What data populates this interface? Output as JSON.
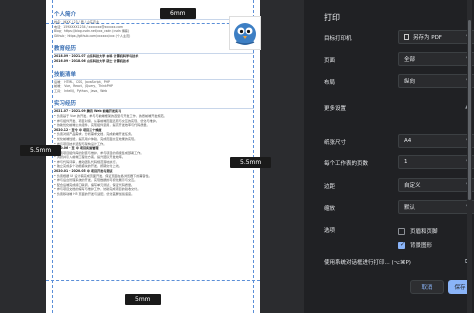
{
  "margins": {
    "top": "6mm",
    "bottom": "5mm",
    "left": "5.5mm",
    "right": "5.5mm"
  },
  "resume": {
    "sections": [
      {
        "title": "个人简介",
        "lines": [
          "姓名：徐XX  |  23 / 男 / 山东农业",
          "电话：159XXXX1234 / xxxxxxx@xxxxxx.com",
          "Blog：https://blog.csdn.net/xxx_csdn  (csdn 博客)",
          "Github：https://github.com/xxxxxx/xxx  (个人主页)"
        ]
      },
      {
        "title": "教育经历",
        "lines": [
          "2018.09 - 2021.07  山东科技大学  本科  计算机科学与技术",
          "2016.09 - 2018.06  山东科技大学  硕士  计算机技术"
        ]
      },
      {
        "title": "技能清单",
        "lines": [
          "后端：  HTML、CSS、JavaScript、PHP",
          "前端：  Vue、React、jQuery、ThinkPHP",
          "工具：  IntelliJ、Python、Java、Web"
        ]
      },
      {
        "title": "实习经历",
        "lines": [
          "2021.07 - 2021.09  腾讯  Web 前端开发实习",
          "负责基于 Vue 的开发，参与与前端框架的选型与开发工作，熟悉前端开发规范。",
          "参与组件开发、项目对接，从事前端页面还原与交互的实现、优化与维护。",
          "协助优化前端公共组件，实现组件复用，提高开发效率与代码质量。",
          "2020.12 - 至今     中    项目三个维度",
          "负责对接产品需求，分析需求文档，完成前端开发任务。",
          "优化前端性能，提高用户体验，完成页面交互效果的实现。",
          "参与项目技术选型与架构设计工作。",
          "2020.06 - 至    中    项目实施管理",
          "负责项目组件库的封装与维护，参与项目的持续集成部署工作。",
          "调研并引入前端工程化方案，提升团队开发效率。",
          "参与代码评审，推动团队代码规范落地执行。",
          "独立完成多个功能模块的开发，按期交付上线。",
          "2020.01 - 2020.05    中    项目开发与测试",
          "负责根据 UI 设计稿完成页面开发，保证页面在各浏览器下的兼容性。",
          "参与后台管理系统的开发，实现数据的可视化展示与交互。",
          "配合后端完成接口联调，编写单元测试，保证代码质量。",
          "参与项目文档的编写与维护工作，协助完成项目的验收交付。",
          "负责移动端 H5 页面的开发与适配，优化首屏加载速度。"
        ]
      }
    ]
  },
  "panel": {
    "title": "打印",
    "destination": {
      "label": "目标打印机",
      "value": "另存为 PDF"
    },
    "pages": {
      "label": "页面",
      "value": "全部"
    },
    "layout": {
      "label": "布局",
      "value": "纵向"
    },
    "more_settings": "更多设置",
    "paper_size": {
      "label": "纸张尺寸",
      "value": "A4"
    },
    "pages_per_sheet": {
      "label": "每个工作表的页数",
      "value": "1"
    },
    "margins": {
      "label": "边距",
      "value": "自定义"
    },
    "scale": {
      "label": "缩放",
      "value": "默认"
    },
    "options": {
      "label": "选项",
      "headers_footers": {
        "label": "页眉和页脚",
        "checked": false
      },
      "background_graphics": {
        "label": "背景图形",
        "checked": true
      }
    },
    "system_dialog": "使用系统对话框进行打印... (⌥⌘P)",
    "cancel": "取消",
    "save": "保存"
  }
}
